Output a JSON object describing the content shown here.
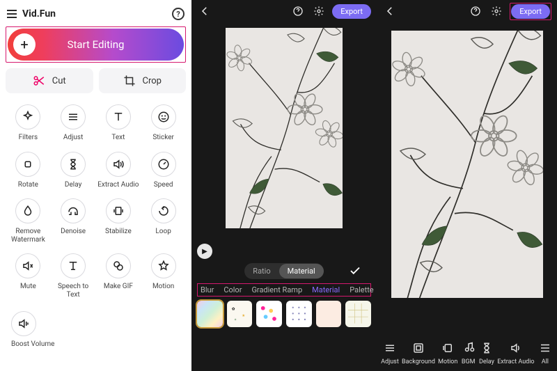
{
  "brand": "Vid.Fun",
  "start_label": "Start Editing",
  "quick": {
    "cut": "Cut",
    "crop": "Crop"
  },
  "tools": {
    "filters": "Filters",
    "adjust": "Adjust",
    "text": "Text",
    "sticker": "Sticker",
    "rotate": "Rotate",
    "delay": "Delay",
    "extract_audio": "Extract Audio",
    "speed": "Speed",
    "remove_wm": "Remove Watermark",
    "denoise": "Denoise",
    "stabilize": "Stabilize",
    "loop": "Loop",
    "mute": "Mute",
    "stt": "Speech to Text",
    "make_gif": "Make GIF",
    "motion": "Motion"
  },
  "boost_volume": "Boost Volume",
  "export_label": "Export",
  "bg_toggle": {
    "ratio": "Ratio",
    "material": "Material"
  },
  "subtabs": {
    "blur": "Blur",
    "color": "Color",
    "gradient": "Gradient Ramp",
    "material": "Material",
    "palette": "Palette"
  },
  "bottom_tools": {
    "adjust": "Adjust",
    "background": "Background",
    "motion": "Motion",
    "bgm": "BGM",
    "delay": "Delay",
    "extract": "Extract Audio",
    "all": "All"
  },
  "colors": {
    "accent": "#d6186e",
    "export": "#7c6cf3"
  }
}
